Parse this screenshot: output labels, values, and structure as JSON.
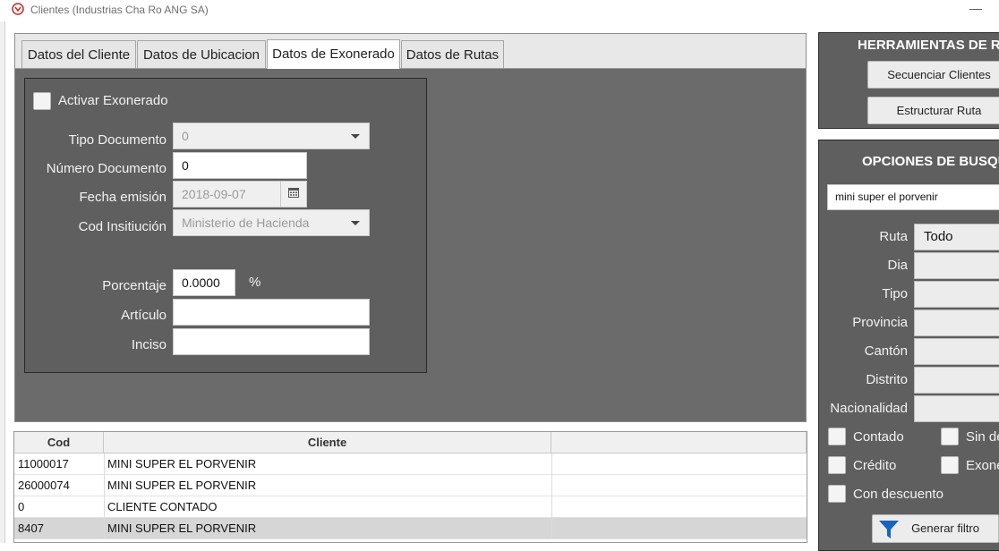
{
  "window": {
    "title": "Clientes (Industrias Cha Ro ANG SA)",
    "minimize_glyph": "—"
  },
  "tabs": [
    {
      "label": "Datos del Cliente"
    },
    {
      "label": "Datos de Ubicacion"
    },
    {
      "label": "Datos de Exonerado"
    },
    {
      "label": "Datos de Rutas"
    }
  ],
  "exonerado": {
    "activar_label": "Activar Exonerado",
    "tipo_documento_label": "Tipo Documento",
    "tipo_documento_value": "0",
    "numero_documento_label": "Número Documento",
    "numero_documento_value": "0",
    "fecha_emision_label": "Fecha emisión",
    "fecha_emision_value": "2018-09-07",
    "cod_institucion_label": "Cod Insitiución",
    "cod_institucion_value": "Ministerio de Hacienda",
    "porcentaje_label": "Porcentaje",
    "porcentaje_value": "0.0000",
    "porcentaje_unit": "%",
    "articulo_label": "Artículo",
    "articulo_value": "",
    "inciso_label": "Inciso",
    "inciso_value": ""
  },
  "table": {
    "headers": [
      "Cod",
      "Cliente",
      ""
    ],
    "rows": [
      {
        "cod": "11000017",
        "cliente": "MINI SUPER EL PORVENIR"
      },
      {
        "cod": "26000074",
        "cliente": "MINI SUPER EL PORVENIR"
      },
      {
        "cod": "0",
        "cliente": "CLIENTE CONTADO"
      },
      {
        "cod": "8407",
        "cliente": "MINI SUPER EL PORVENIR"
      }
    ]
  },
  "herramientas": {
    "title": "HERRAMIENTAS DE RU",
    "secuenciar_label": "Secuenciar Clientes",
    "estructurar_label": "Estructurar Ruta"
  },
  "busqueda": {
    "title": "OPCIONES DE BUSQU",
    "search_value": "mini super el porvenir",
    "ruta_label": "Ruta",
    "ruta_value": "Todo",
    "dia_label": "Dia",
    "tipo_label": "Tipo",
    "provincia_label": "Provincia",
    "canton_label": "Cantón",
    "distrito_label": "Distrito",
    "nacionalidad_label": "Nacionalidad",
    "contado_label": "Contado",
    "sin_de_label": "Sin de",
    "credito_label": "Crédito",
    "exone_label": "Exone",
    "con_descuento_label": "Con descuento",
    "generar_label": "Generar filtro"
  },
  "colors": {
    "panel": "#5f5f5f",
    "tab_bg": "#6b6b6b",
    "filter_icon": "#1565c0"
  }
}
